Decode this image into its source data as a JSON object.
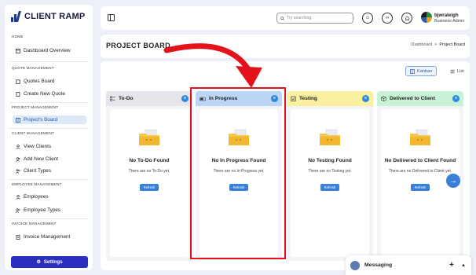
{
  "brand": {
    "name": "CLIENT RAMP"
  },
  "sidebar": {
    "sections": [
      {
        "title": "HOME",
        "items": [
          {
            "label": "Dashboard Overview"
          }
        ]
      },
      {
        "title": "QUOTE MANAGEMENT",
        "items": [
          {
            "label": "Quotes Board"
          },
          {
            "label": "Create New Quote"
          }
        ]
      },
      {
        "title": "PROJECT MANAGEMENT",
        "items": [
          {
            "label": "Project's Board",
            "active": true
          }
        ]
      },
      {
        "title": "CLIENT MANAGEMENT",
        "items": [
          {
            "label": "View Clients"
          },
          {
            "label": "Add New Client"
          },
          {
            "label": "Client Types"
          }
        ]
      },
      {
        "title": "EMPLOYEE MANAGEMENT",
        "items": [
          {
            "label": "Employees"
          },
          {
            "label": "Employee Types"
          }
        ]
      },
      {
        "title": "INVOICE MANAGEMENT",
        "items": [
          {
            "label": "Invoice Management"
          }
        ]
      }
    ],
    "settings_label": "Settings"
  },
  "topbar": {
    "search_placeholder": "Try searching",
    "user_name": "bjwraleigh",
    "user_role": "Business Admin"
  },
  "header": {
    "title": "PROJECT BOARD",
    "breadcrumb": [
      "Dashboard",
      ">",
      "Project Board"
    ]
  },
  "views": {
    "kanban": "Kanban",
    "list": "List"
  },
  "columns": [
    {
      "title": "To-Do",
      "count": "0",
      "header_color": "#e4e6ec",
      "empty_title": "No To-Do Found",
      "empty_sub": "There are no To-Do yet.",
      "refresh": "Refresh"
    },
    {
      "title": "In Progress",
      "count": "0",
      "header_color": "#bcd4f6",
      "empty_title": "No In Progress Found",
      "empty_sub": "There are no In Progress yet.",
      "refresh": "Refresh"
    },
    {
      "title": "Testing",
      "count": "0",
      "header_color": "#faf0a0",
      "empty_title": "No Testing Found",
      "empty_sub": "There are no Testing yet.",
      "refresh": "Refresh"
    },
    {
      "title": "Delivered to Client",
      "count": "0",
      "header_color": "#c8f2d6",
      "empty_title": "No Delivered to Client Found",
      "empty_sub": "There are no Delivered to Client yet.",
      "refresh": "Refresh"
    }
  ],
  "messaging": {
    "label": "Messaging"
  },
  "colors": {
    "accent": "#2a2fbf",
    "badge": "#2b8ae0",
    "annotation": "#e3121b"
  }
}
